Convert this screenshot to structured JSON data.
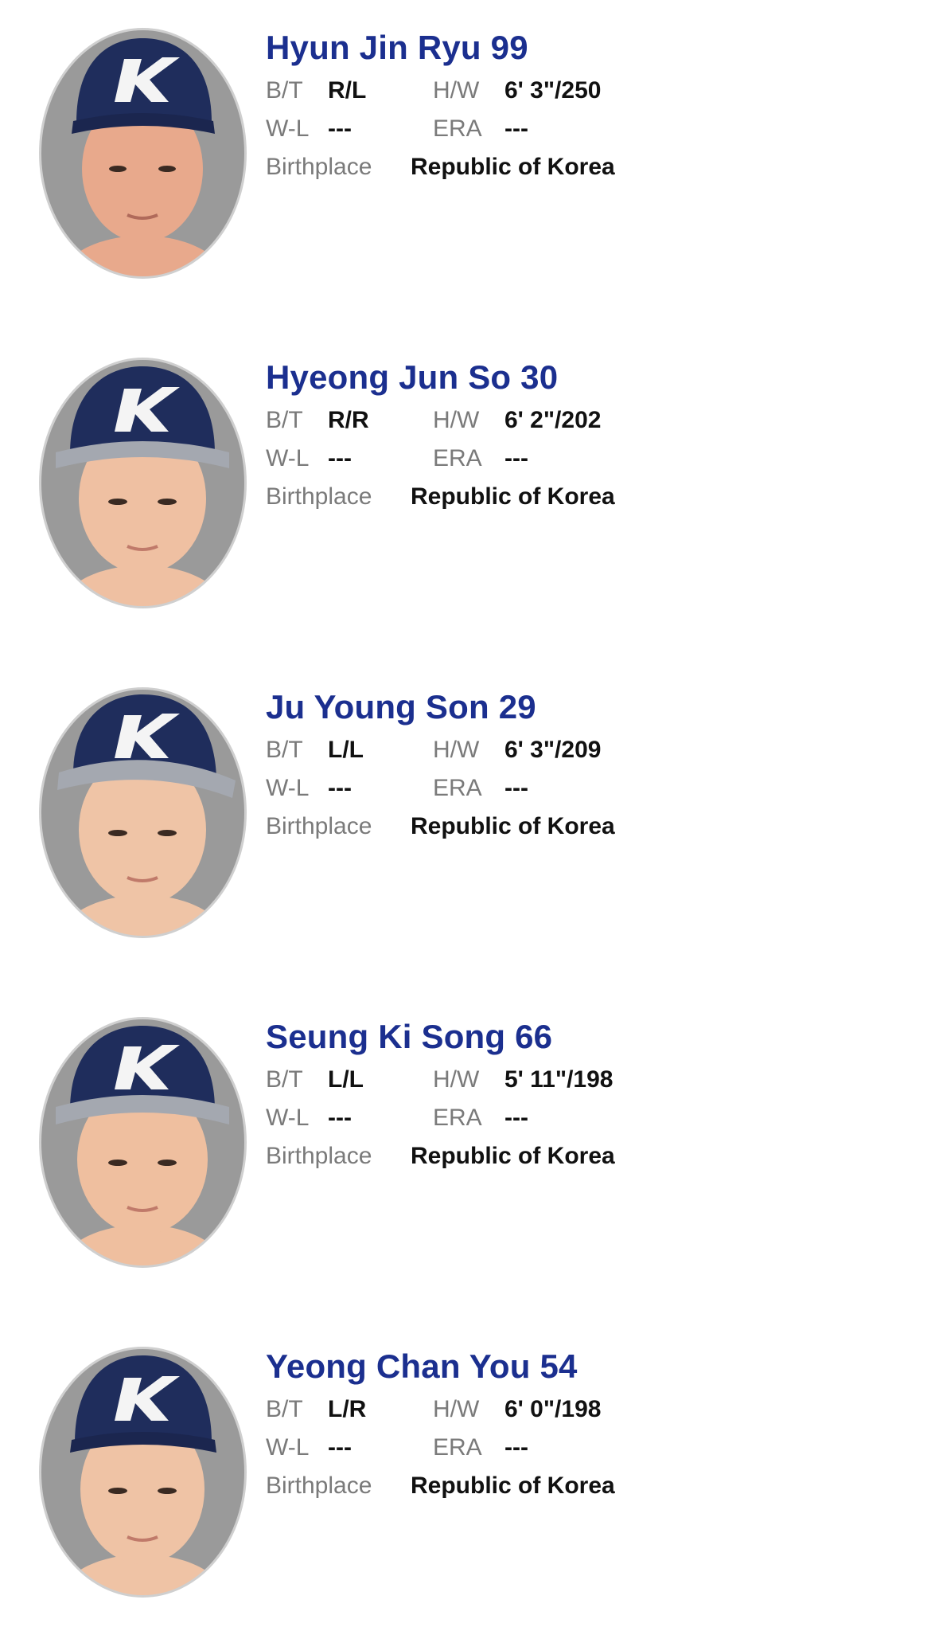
{
  "labels": {
    "bt": "B/T",
    "hw": "H/W",
    "wl": "W-L",
    "era": "ERA",
    "birthplace": "Birthplace"
  },
  "colors": {
    "name": "#1b2f8f",
    "cap": "#1f2d5c",
    "photo_bg": "#9a9a9a",
    "skin": "#e8a98c"
  },
  "players": [
    {
      "name": "Hyun Jin Ryu 99",
      "bt": "R/L",
      "hw": "6' 3\"/250",
      "wl": "---",
      "era": "---",
      "birthplace": "Republic of Korea"
    },
    {
      "name": "Hyeong Jun So 30",
      "bt": "R/R",
      "hw": "6' 2\"/202",
      "wl": "---",
      "era": "---",
      "birthplace": "Republic of Korea"
    },
    {
      "name": "Ju Young Son 29",
      "bt": "L/L",
      "hw": "6' 3\"/209",
      "wl": "---",
      "era": "---",
      "birthplace": "Republic of Korea"
    },
    {
      "name": "Seung Ki Song 66",
      "bt": "L/L",
      "hw": "5' 11\"/198",
      "wl": "---",
      "era": "---",
      "birthplace": "Republic of Korea"
    },
    {
      "name": "Yeong Chan You 54",
      "bt": "L/R",
      "hw": "6' 0\"/198",
      "wl": "---",
      "era": "---",
      "birthplace": "Republic of Korea"
    }
  ]
}
